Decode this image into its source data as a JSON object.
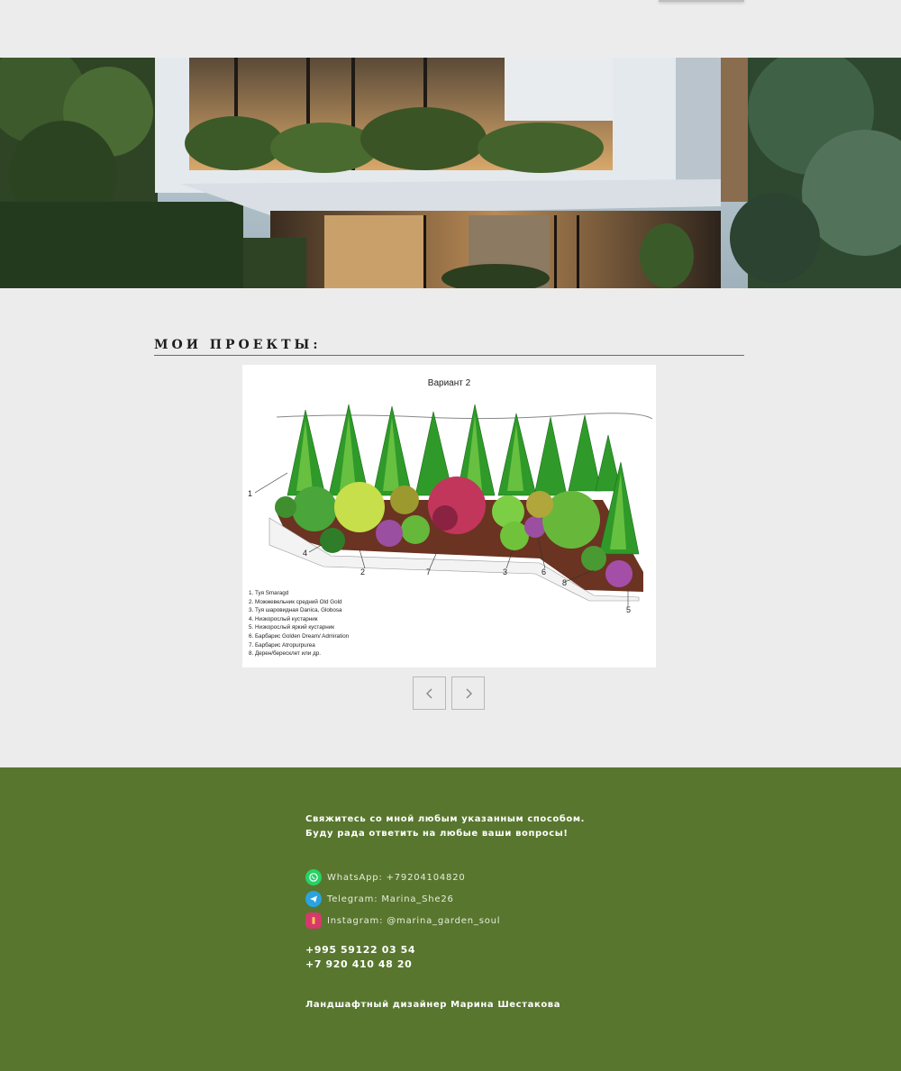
{
  "projects": {
    "heading": "МОИ ПРОЕКТЫ:",
    "slide": {
      "caption": "Вариант 2",
      "legend": [
        "1. Туя Smaragd",
        "2. Можжевельник средний Old Gold",
        "3. Туя шаровидная Danica, Globosa",
        "4. Низкорослый кустарник",
        "5. Низкорослый яркий кустарник",
        "6. Барбарис Golden Dream/ Admiration",
        "7. Барбарис Atropurpurea",
        "8. Дерен/бересклет или др."
      ],
      "numbers": [
        "1",
        "2",
        "3",
        "4",
        "5",
        "6",
        "7",
        "8"
      ]
    },
    "prev_icon": "chevron-left-icon",
    "next_icon": "chevron-right-icon"
  },
  "footer": {
    "intro_line1": "Свяжитесь со мной любым указанным способом.",
    "intro_line2": "Буду рада ответить на любые ваши вопросы!",
    "contacts": [
      {
        "icon": "whatsapp-icon",
        "label": "WhatsApp: +79204104820",
        "color": "#25d366"
      },
      {
        "icon": "telegram-icon",
        "label": "Telegram: Marina_She26",
        "color": "#2aa3e0"
      },
      {
        "icon": "instagram-icon",
        "label": "Instagram: @marina_garden_soul",
        "color": "#d6396b"
      }
    ],
    "phone1": "+995 59122 03 54",
    "phone2": "+7 920 410 48 20",
    "signature": "Ландшафтный дизайнер Марина Шестакова"
  },
  "colors": {
    "page_bg": "#ececec",
    "footer_bg": "#58762e",
    "accent_rule": "#5b7a2e"
  }
}
